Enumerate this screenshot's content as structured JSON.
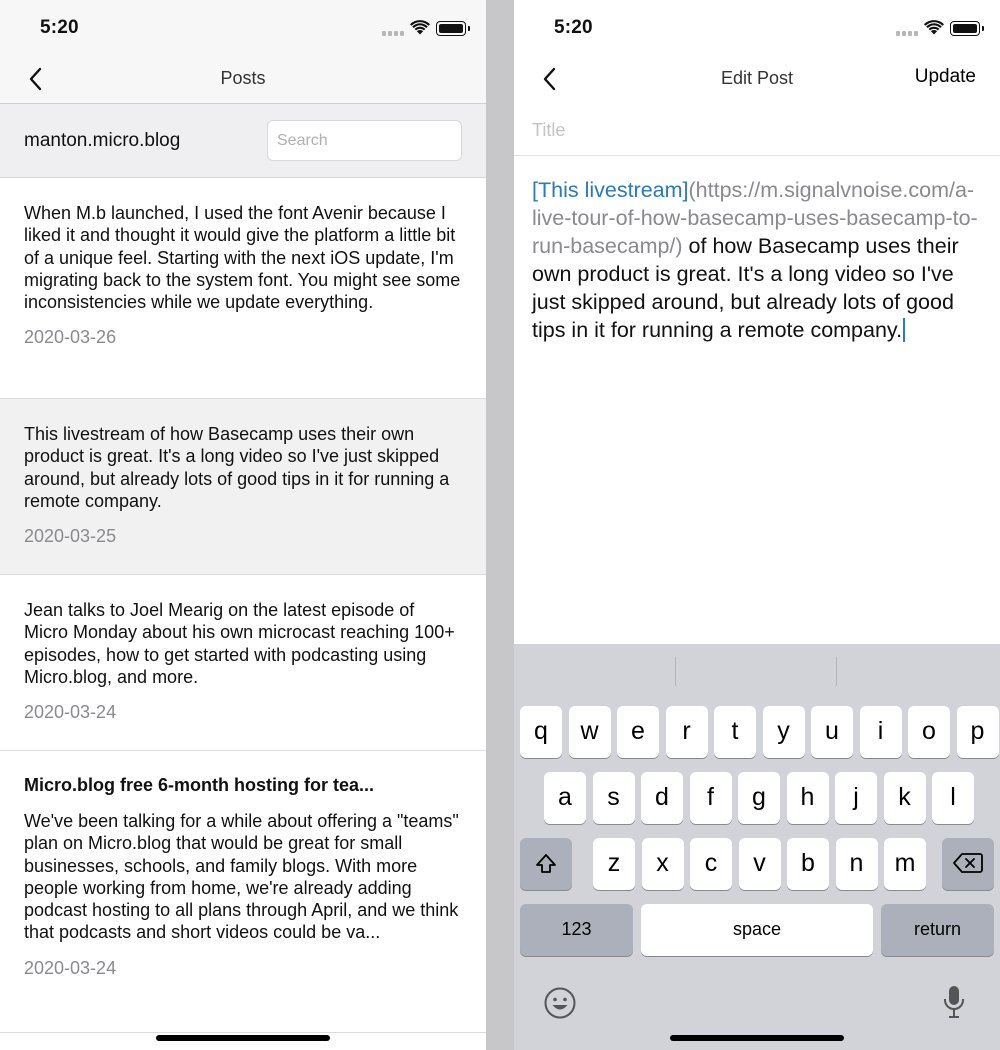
{
  "status_bar": {
    "time": "5:20"
  },
  "posts_screen": {
    "nav_title": "Posts",
    "account": "manton.micro.blog",
    "search_placeholder": "Search",
    "posts": [
      {
        "title": "",
        "body": "When M.b launched, I used the font Avenir because I liked it and thought it would give the platform a little bit of a unique feel. Starting with the next iOS update, I'm migrating back to the system font. You might see some inconsistencies while we update everything.",
        "date": "2020-03-26"
      },
      {
        "title": "",
        "body": "This livestream of how Basecamp uses their own product is great. It's a long video so I've just skipped around, but already lots of good tips in it for running a remote company.",
        "date": "2020-03-25",
        "selected": true
      },
      {
        "title": "",
        "body": "Jean talks to Joel Mearig on the latest episode of Micro Monday about his own microcast reaching 100+ episodes, how to get started with podcasting using Micro.blog, and more.",
        "date": "2020-03-24"
      },
      {
        "title": "Micro.blog free 6-month hosting for tea...",
        "body": "We've been talking for a while about offering a \"teams\" plan on Micro.blog that would be great for small businesses, schools, and family blogs. With more people working from home, we're already adding podcast hosting to all plans through April, and we think that podcasts and short videos could be va...",
        "date": "2020-03-24"
      }
    ]
  },
  "edit_screen": {
    "nav_title": "Edit Post",
    "update_label": "Update",
    "title_placeholder": "Title",
    "content": {
      "link_text": "[This livestream]",
      "link_url": "(https://m.signalvnoise.com/a-live-tour-of-how-basecamp-uses-basecamp-to-run-basecamp/)",
      "rest": " of how Basecamp uses their own product is great. It's a long video so I've just skipped around, but already lots of good tips in it for running a remote company."
    }
  },
  "keyboard": {
    "row1": [
      "q",
      "w",
      "e",
      "r",
      "t",
      "y",
      "u",
      "i",
      "o",
      "p"
    ],
    "row2": [
      "a",
      "s",
      "d",
      "f",
      "g",
      "h",
      "j",
      "k",
      "l"
    ],
    "row3": [
      "z",
      "x",
      "c",
      "v",
      "b",
      "n",
      "m"
    ],
    "numbers_label": "123",
    "space_label": "space",
    "return_label": "return"
  },
  "icons": [
    "back-chevron-icon",
    "wifi-icon",
    "battery-icon",
    "cellular-signal-icon",
    "shift-icon",
    "backspace-icon",
    "emoji-icon",
    "microphone-icon"
  ]
}
